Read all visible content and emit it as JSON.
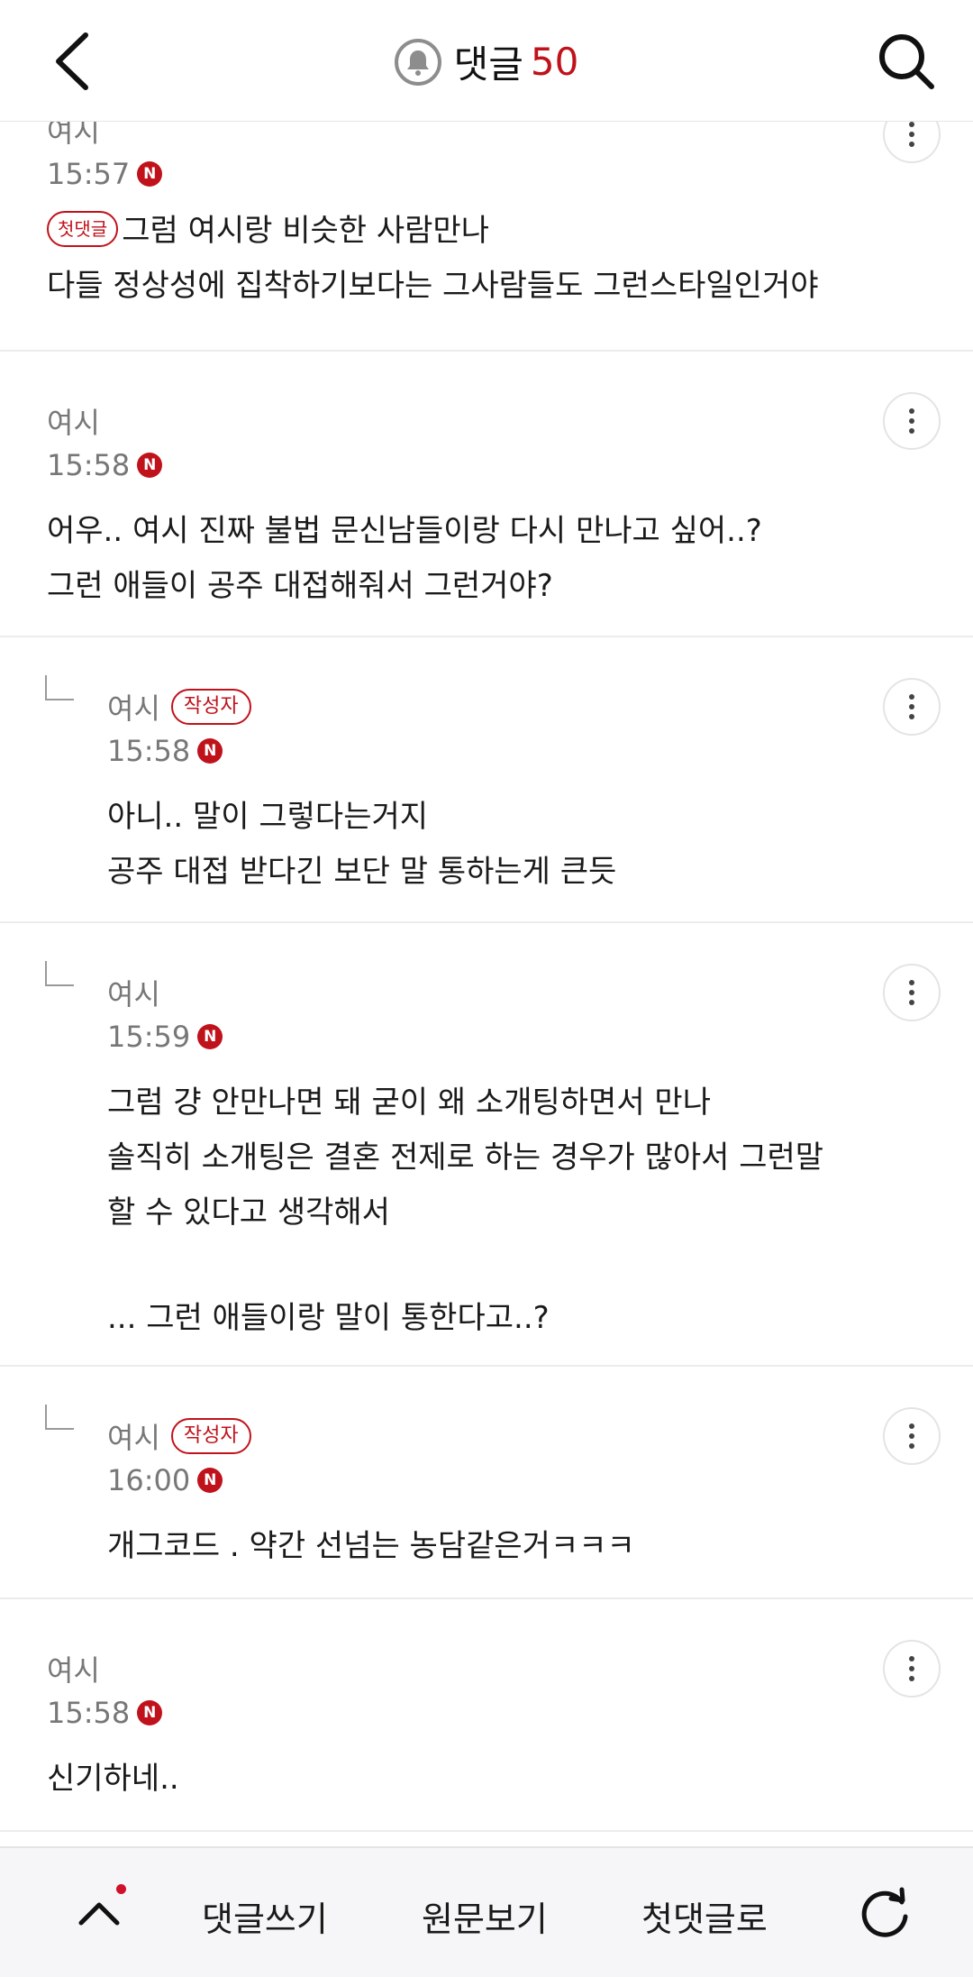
{
  "header": {
    "back_icon": "chevron-left-icon",
    "bell_icon": "bell-icon",
    "title": "댓글",
    "count": "50",
    "search_icon": "search-icon"
  },
  "comments": [
    {
      "name": "여시",
      "author_badge": "",
      "time": "15:57",
      "new_badge": "N",
      "first_badge": "첫댓글",
      "lines": [
        "그럼 여시랑 비슷한 사람만나",
        "다들 정상성에 집착하기보다는 그사람들도 그런스타일인거야"
      ]
    },
    {
      "name": "여시",
      "author_badge": "",
      "time": "15:58",
      "new_badge": "N",
      "lines": [
        "어우.. 여시 진짜 불법 문신남들이랑 다시 만나고 싶어..?",
        "그런 애들이 공주 대접해줘서 그런거야?"
      ]
    },
    {
      "name": "여시",
      "author_badge": "작성자",
      "time": "15:58",
      "new_badge": "N",
      "lines": [
        "아니.. 말이 그렇다는거지",
        "공주 대접 받다긴 보단 말 통하는게 큰듯"
      ]
    },
    {
      "name": "여시",
      "author_badge": "",
      "time": "15:59",
      "new_badge": "N",
      "lines": [
        "그럼 걍 안만나면 돼 굳이 왜 소개팅하면서 만나",
        "솔직히 소개팅은 결혼 전제로 하는 경우가 많아서 그런말",
        "할 수 있다고 생각해서",
        "",
        "... 그런 애들이랑 말이 통한다고..?"
      ]
    },
    {
      "name": "여시",
      "author_badge": "작성자",
      "time": "16:00",
      "new_badge": "N",
      "lines": [
        "개그코드 . 약간 선넘는 농담같은거ㅋㅋㅋ"
      ]
    },
    {
      "name": "여시",
      "author_badge": "",
      "time": "15:58",
      "new_badge": "N",
      "lines": [
        "신기하네.."
      ]
    }
  ],
  "bottom_bar": {
    "up_icon": "chevron-up-icon",
    "write_label": "댓글쓰기",
    "original_label": "원문보기",
    "first_comment_label": "첫댓글로",
    "refresh_icon": "refresh-icon"
  },
  "colors": {
    "accent": "#c0121b",
    "text": "#1a1a1a",
    "meta": "#777777",
    "divider": "#ececec",
    "bottom_bar_bg": "#f6f6f8"
  }
}
